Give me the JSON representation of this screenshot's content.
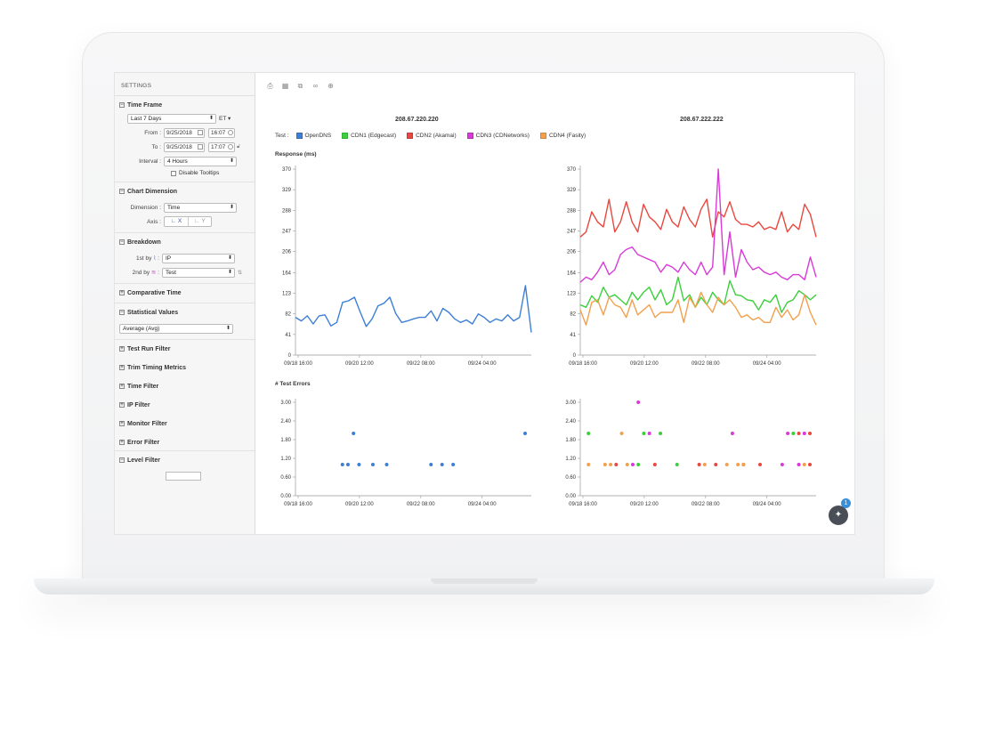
{
  "sidebar": {
    "header": "SETTINGS",
    "time_frame": {
      "title": "Time Frame",
      "range": "Last 7 Days",
      "timezone": "ET",
      "from_label": "From :",
      "from_date": "9/25/2018",
      "from_time": "16:07",
      "to_label": "To :",
      "to_date": "9/25/2018",
      "to_time": "17:07",
      "interval_label": "Interval :",
      "interval": "4 Hours",
      "disable_tooltips": "Disable Tooltips"
    },
    "chart_dimension": {
      "title": "Chart Dimension",
      "dimension_label": "Dimension :",
      "dimension": "Time",
      "axis_label": "Axis :",
      "axis_x": "X",
      "axis_y": "Y"
    },
    "breakdown": {
      "title": "Breakdown",
      "first_label": "1st by",
      "first_value": "IP",
      "second_label": "2nd by",
      "second_value": "Test"
    },
    "comparative_time": "Comparative Time",
    "statistical_values": {
      "title": "Statistical Values",
      "value": "Average (Avg)"
    },
    "filters": [
      "Test Run Filter",
      "Trim Timing Metrics",
      "Time Filter",
      "IP Filter",
      "Monitor Filter",
      "Error Filter"
    ],
    "level_filter": "Level Filter"
  },
  "toolbar": {
    "icons": [
      "print-icon",
      "table-icon",
      "export-icon",
      "link-icon",
      "add-chart-icon"
    ]
  },
  "legend": {
    "label": "Test :",
    "items": [
      {
        "name": "OpenDNS",
        "color": "#3d7fd6"
      },
      {
        "name": "CDN1 (Edgecast)",
        "color": "#3ccf3c"
      },
      {
        "name": "CDN2 (Akamai)",
        "color": "#e8483f"
      },
      {
        "name": "CDN3 (CDNetworks)",
        "color": "#d83ad8"
      },
      {
        "name": "CDN4 (Fasity)",
        "color": "#f2a04e"
      }
    ]
  },
  "notifications": {
    "badge_count": "1"
  },
  "chart_data": [
    {
      "type": "line",
      "title": "208.67.220.220",
      "ylabel": "Response (ms)",
      "xticks": [
        "09/18 16:00",
        "09/20 12:00",
        "09/22 08:00",
        "09/24 04:00"
      ],
      "yticks": [
        0,
        41,
        82,
        123,
        164,
        206,
        247,
        288,
        329,
        370
      ],
      "ylim": [
        0,
        370
      ],
      "series": [
        {
          "name": "OpenDNS",
          "color": "#3d7fd6",
          "values": [
            75,
            68,
            78,
            62,
            78,
            80,
            58,
            65,
            105,
            108,
            115,
            85,
            57,
            72,
            98,
            103,
            115,
            83,
            65,
            68,
            72,
            75,
            75,
            88,
            68,
            93,
            85,
            72,
            65,
            70,
            62,
            82,
            75,
            65,
            72,
            68,
            80,
            68,
            75,
            138,
            45
          ]
        }
      ]
    },
    {
      "type": "line",
      "title": "208.67.222.222",
      "ylabel": "",
      "xticks": [
        "09/18 16:00",
        "09/20 12:00",
        "09/22 08:00",
        "09/24 04:00"
      ],
      "yticks": [
        0,
        41,
        82,
        123,
        164,
        206,
        247,
        288,
        329,
        370
      ],
      "ylim": [
        0,
        370
      ],
      "series": [
        {
          "name": "CDN2 (Akamai)",
          "color": "#e8483f",
          "values": [
            235,
            245,
            285,
            265,
            255,
            310,
            245,
            265,
            305,
            265,
            245,
            300,
            275,
            265,
            250,
            290,
            265,
            255,
            295,
            270,
            255,
            290,
            310,
            235,
            285,
            275,
            305,
            270,
            260,
            260,
            255,
            265,
            250,
            255,
            250,
            285,
            245,
            260,
            250,
            300,
            280,
            235
          ]
        },
        {
          "name": "CDN3 (CDNetworks)",
          "color": "#d83ad8",
          "values": [
            145,
            155,
            150,
            165,
            185,
            160,
            170,
            200,
            210,
            215,
            200,
            195,
            190,
            185,
            165,
            180,
            175,
            165,
            185,
            170,
            160,
            185,
            160,
            175,
            370,
            160,
            245,
            155,
            210,
            185,
            170,
            175,
            165,
            160,
            165,
            155,
            150,
            160,
            160,
            150,
            195,
            155
          ]
        },
        {
          "name": "CDN1 (Edgecast)",
          "color": "#3ccf3c",
          "values": [
            100,
            95,
            118,
            105,
            135,
            115,
            120,
            110,
            100,
            125,
            110,
            125,
            135,
            110,
            130,
            100,
            110,
            155,
            108,
            120,
            95,
            115,
            100,
            125,
            110,
            100,
            148,
            120,
            118,
            110,
            108,
            90,
            110,
            105,
            120,
            85,
            105,
            110,
            128,
            120,
            110,
            120
          ]
        },
        {
          "name": "CDN4 (Fasity)",
          "color": "#f2a04e",
          "values": [
            90,
            60,
            105,
            110,
            80,
            115,
            100,
            95,
            75,
            110,
            80,
            90,
            100,
            75,
            85,
            85,
            85,
            110,
            65,
            115,
            95,
            125,
            100,
            85,
            115,
            100,
            110,
            95,
            75,
            80,
            70,
            75,
            65,
            65,
            95,
            75,
            90,
            70,
            80,
            120,
            85,
            60
          ]
        }
      ]
    },
    {
      "type": "scatter",
      "title": "",
      "ylabel": "# Test Errors",
      "xticks": [
        "09/18 16:00",
        "09/20 12:00",
        "09/22 08:00",
        "09/24 04:00"
      ],
      "yticks": [
        "0.00",
        "0.60",
        "1.20",
        "1.80",
        "2.40",
        "3.00"
      ],
      "ylim": [
        0,
        3
      ],
      "series": [
        {
          "name": "OpenDNS",
          "color": "#3d7fd6",
          "points": [
            [
              8,
              1
            ],
            [
              9,
              1
            ],
            [
              10,
              2
            ],
            [
              11,
              1
            ],
            [
              13.5,
              1
            ],
            [
              16,
              1
            ],
            [
              24,
              1
            ],
            [
              26,
              1
            ],
            [
              28,
              1
            ],
            [
              41,
              2
            ]
          ]
        }
      ]
    },
    {
      "type": "scatter",
      "title": "",
      "ylabel": "",
      "xticks": [
        "09/18 16:00",
        "09/20 12:00",
        "09/22 08:00",
        "09/24 04:00"
      ],
      "yticks": [
        "0.00",
        "0.60",
        "1.20",
        "1.80",
        "2.40",
        "3.00"
      ],
      "ylim": [
        0,
        3
      ],
      "series": [
        {
          "name": "CDN1 (Edgecast)",
          "color": "#3ccf3c",
          "points": [
            [
              1,
              2
            ],
            [
              10,
              1
            ],
            [
              11,
              2
            ],
            [
              14,
              2
            ],
            [
              17,
              1
            ],
            [
              38,
              2
            ]
          ]
        },
        {
          "name": "CDN2 (Akamai)",
          "color": "#e8483f",
          "points": [
            [
              6,
              1
            ],
            [
              13,
              1
            ],
            [
              21,
              1
            ],
            [
              24,
              1
            ],
            [
              29,
              1
            ],
            [
              32,
              1
            ],
            [
              39,
              2
            ],
            [
              41,
              1
            ],
            [
              41,
              2
            ]
          ]
        },
        {
          "name": "CDN3 (CDNetworks)",
          "color": "#d83ad8",
          "points": [
            [
              9,
              1
            ],
            [
              10,
              3
            ],
            [
              12,
              2
            ],
            [
              27,
              2
            ],
            [
              36,
              1
            ],
            [
              37,
              2
            ],
            [
              39,
              1
            ],
            [
              40,
              2
            ]
          ]
        },
        {
          "name": "CDN4 (Fasity)",
          "color": "#f2a04e",
          "points": [
            [
              1,
              1
            ],
            [
              4,
              1
            ],
            [
              5,
              1
            ],
            [
              7,
              2
            ],
            [
              8,
              1
            ],
            [
              22,
              1
            ],
            [
              26,
              1
            ],
            [
              28,
              1
            ],
            [
              29,
              1
            ],
            [
              40,
              1
            ]
          ]
        }
      ]
    }
  ]
}
